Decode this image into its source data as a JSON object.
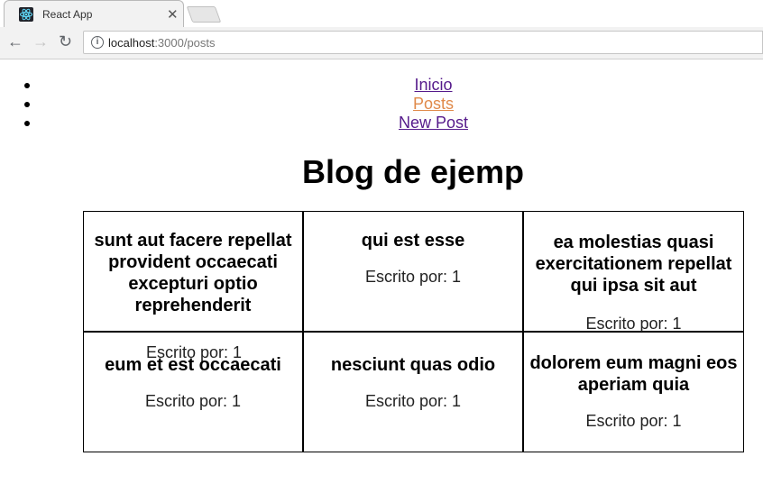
{
  "browser": {
    "tab_title": "React App",
    "url_host": "localhost",
    "url_path": ":3000/posts"
  },
  "nav": {
    "items": [
      {
        "label": "Inicio"
      },
      {
        "label": "Posts"
      },
      {
        "label": "New Post"
      }
    ]
  },
  "page": {
    "title": "Blog de ejemp"
  },
  "posts": [
    {
      "title": "sunt aut facere repellat provident occaecati excepturi optio reprehenderit",
      "author": "Escrito por: 1"
    },
    {
      "title": "qui est esse",
      "author": "Escrito por: 1"
    },
    {
      "title": "ea molestias quasi exercitationem repellat qui ipsa sit aut",
      "author": "Escrito por: 1"
    },
    {
      "title": "eum et est occaecati",
      "author": "Escrito por: 1"
    },
    {
      "title": "nesciunt quas odio",
      "author": "Escrito por: 1"
    },
    {
      "title": "dolorem eum magni eos aperiam quia",
      "author": "Escrito por: 1"
    }
  ]
}
